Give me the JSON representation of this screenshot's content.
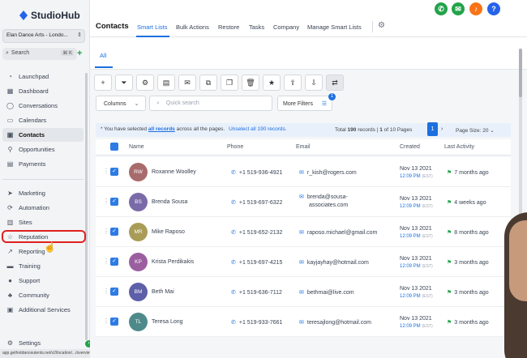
{
  "app": {
    "name": "StudioHub",
    "account": "Elan Dance Arts - Londo...",
    "search": {
      "placeholder": "Search",
      "shortcut": "⌘ K"
    }
  },
  "sidebar": {
    "items": [
      {
        "label": "Launchpad",
        "icon": "rocket-icon"
      },
      {
        "label": "Dashboard",
        "icon": "dashboard-icon"
      },
      {
        "label": "Conversations",
        "icon": "chat-icon"
      },
      {
        "label": "Calendars",
        "icon": "calendar-icon"
      },
      {
        "label": "Contacts",
        "icon": "contacts-icon",
        "active": true
      },
      {
        "label": "Opportunities",
        "icon": "funnel-icon"
      },
      {
        "label": "Payments",
        "icon": "payments-icon"
      },
      {
        "label": "Marketing",
        "icon": "send-icon"
      },
      {
        "label": "Automation",
        "icon": "automation-icon"
      },
      {
        "label": "Sites",
        "icon": "globe-icon"
      },
      {
        "label": "Reputation",
        "icon": "star-icon"
      },
      {
        "label": "Reporting",
        "icon": "trend-icon"
      },
      {
        "label": "Training",
        "icon": "book-icon"
      },
      {
        "label": "Support",
        "icon": "help-icon"
      },
      {
        "label": "Community",
        "icon": "people-icon"
      },
      {
        "label": "Additional Services",
        "icon": "briefcase-icon"
      },
      {
        "label": "Settings",
        "icon": "gear-icon"
      }
    ],
    "status_url": "app.gethotdanceutents.net/v2/location/.../overview"
  },
  "header": {
    "title": "Contacts",
    "tabs": [
      "Smart Lists",
      "Bulk Actions",
      "Restore",
      "Tasks",
      "Company",
      "Manage Smart Lists"
    ],
    "active_tab": "Smart Lists",
    "icons": [
      {
        "name": "phone-icon",
        "color": "#22a34a",
        "glyph": "✆"
      },
      {
        "name": "megaphone-icon",
        "color": "#22a34a",
        "glyph": "✉"
      },
      {
        "name": "bell-icon",
        "color": "#f97316",
        "glyph": "♪"
      },
      {
        "name": "help-icon",
        "color": "#2563eb",
        "glyph": "?"
      }
    ]
  },
  "subtab": "All",
  "toolbar": {
    "icons": [
      "plus-icon",
      "filter-icon",
      "robot-icon",
      "message-icon",
      "email-icon",
      "copy-icon",
      "clipboard-icon",
      "trash-icon",
      "star-icon",
      "export-icon",
      "import-icon",
      "merge-icon"
    ],
    "glyphs": [
      "+",
      "⏷",
      "⚙",
      "▤",
      "✉",
      "⧉",
      "❐",
      "🗑",
      "★",
      "⇪",
      "⇩",
      "⇄"
    ],
    "columns_label": "Columns",
    "quick_search_placeholder": "Quick search",
    "more_filters_label": "More Filters",
    "filters_badge": "1"
  },
  "selection_bar": {
    "text_prefix": "* You have selected",
    "all_records": "all records",
    "text_suffix": "across all the pages.",
    "unselect": "Unselect all 190 records.",
    "total_label": "Total",
    "total_count": "190",
    "records_label": "records |",
    "page_info": "1",
    "page_info_suffix": "of 10 Pages",
    "current_page": "1",
    "page_size_label": "Page Size: 20"
  },
  "table": {
    "headers": [
      "Name",
      "Phone",
      "Email",
      "Created",
      "Last Activity"
    ],
    "rows": [
      {
        "initials": "RW",
        "color": "#a86b6b",
        "name": "Roxanne Woolley",
        "phone": "+1 519-936-4921",
        "email": "r_kish@rogers.com",
        "email2": "",
        "created_date": "Nov 13 2021",
        "created_time": "12:09 PM",
        "tz": "(EST)",
        "last_activity": "7 months ago"
      },
      {
        "initials": "BS",
        "color": "#7a6aa8",
        "name": "Brenda Sousa",
        "phone": "+1 519-697-6322",
        "email": "brenda@sousa-",
        "email2": "associates.com",
        "created_date": "Nov 13 2021",
        "created_time": "12:09 PM",
        "tz": "(EST)",
        "last_activity": "4 weeks ago"
      },
      {
        "initials": "MR",
        "color": "#a99c57",
        "name": "Mike Raposo",
        "phone": "+1 519-652-2132",
        "email": "raposo.michael@gmail.com",
        "email2": "",
        "created_date": "Nov 13 2021",
        "created_time": "12:09 PM",
        "tz": "(EST)",
        "last_activity": "8 months ago"
      },
      {
        "initials": "KP",
        "color": "#9b5fa0",
        "name": "Krista Perdikakis",
        "phone": "+1 519-697-4215",
        "email": "kayjayhay@hotmail.com",
        "email2": "",
        "created_date": "Nov 13 2021",
        "created_time": "12:09 PM",
        "tz": "(EST)",
        "last_activity": "3 months ago"
      },
      {
        "initials": "BM",
        "color": "#5d5fa8",
        "name": "Beth Mai",
        "phone": "+1 519-636-7112",
        "email": "bethmai@live.com",
        "email2": "",
        "created_date": "Nov 13 2021",
        "created_time": "12:09 PM",
        "tz": "(EST)",
        "last_activity": "3 months ago"
      },
      {
        "initials": "TL",
        "color": "#4f8a8b",
        "name": "Teresa Long",
        "phone": "+1 519-933-7661",
        "email": "teresajlong@hotmail.com",
        "email2": "",
        "created_date": "Nov 13 2021",
        "created_time": "12:09 PM",
        "tz": "(EST)",
        "last_activity": "3 months ago"
      }
    ]
  }
}
